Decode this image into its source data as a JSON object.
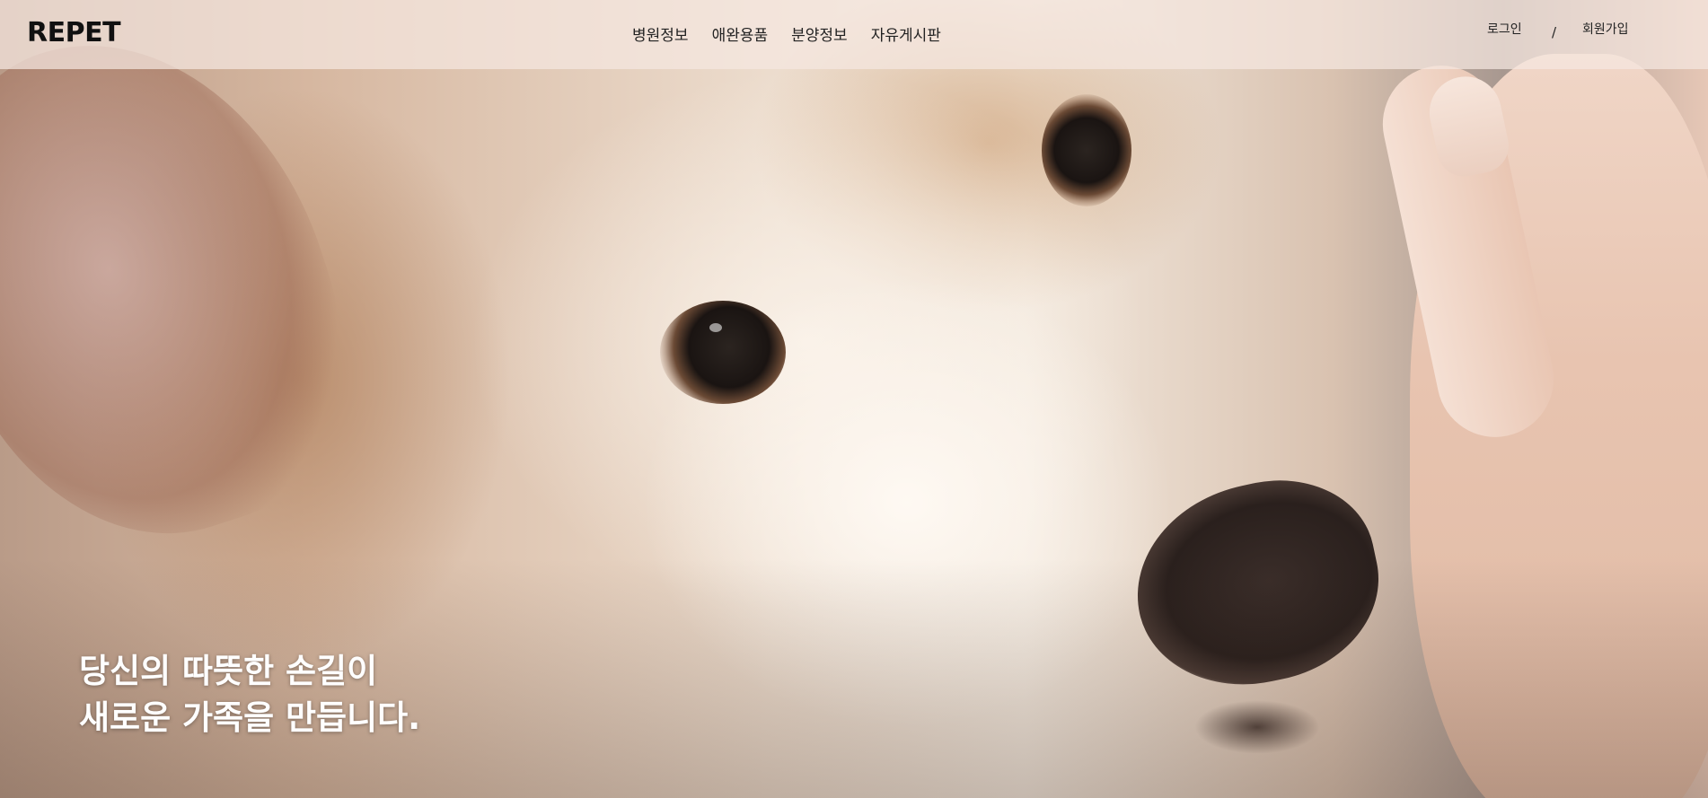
{
  "header": {
    "logo": "REPET",
    "nav": [
      {
        "label": "병원정보"
      },
      {
        "label": "애완용품"
      },
      {
        "label": "분양정보"
      },
      {
        "label": "자유게시판"
      }
    ],
    "auth": {
      "login": "로그인",
      "separator": "/",
      "signup": "회원가입"
    }
  },
  "hero": {
    "line1": "당신의 따뜻한 손길이",
    "line2": "새로운 가족을 만듭니다."
  }
}
